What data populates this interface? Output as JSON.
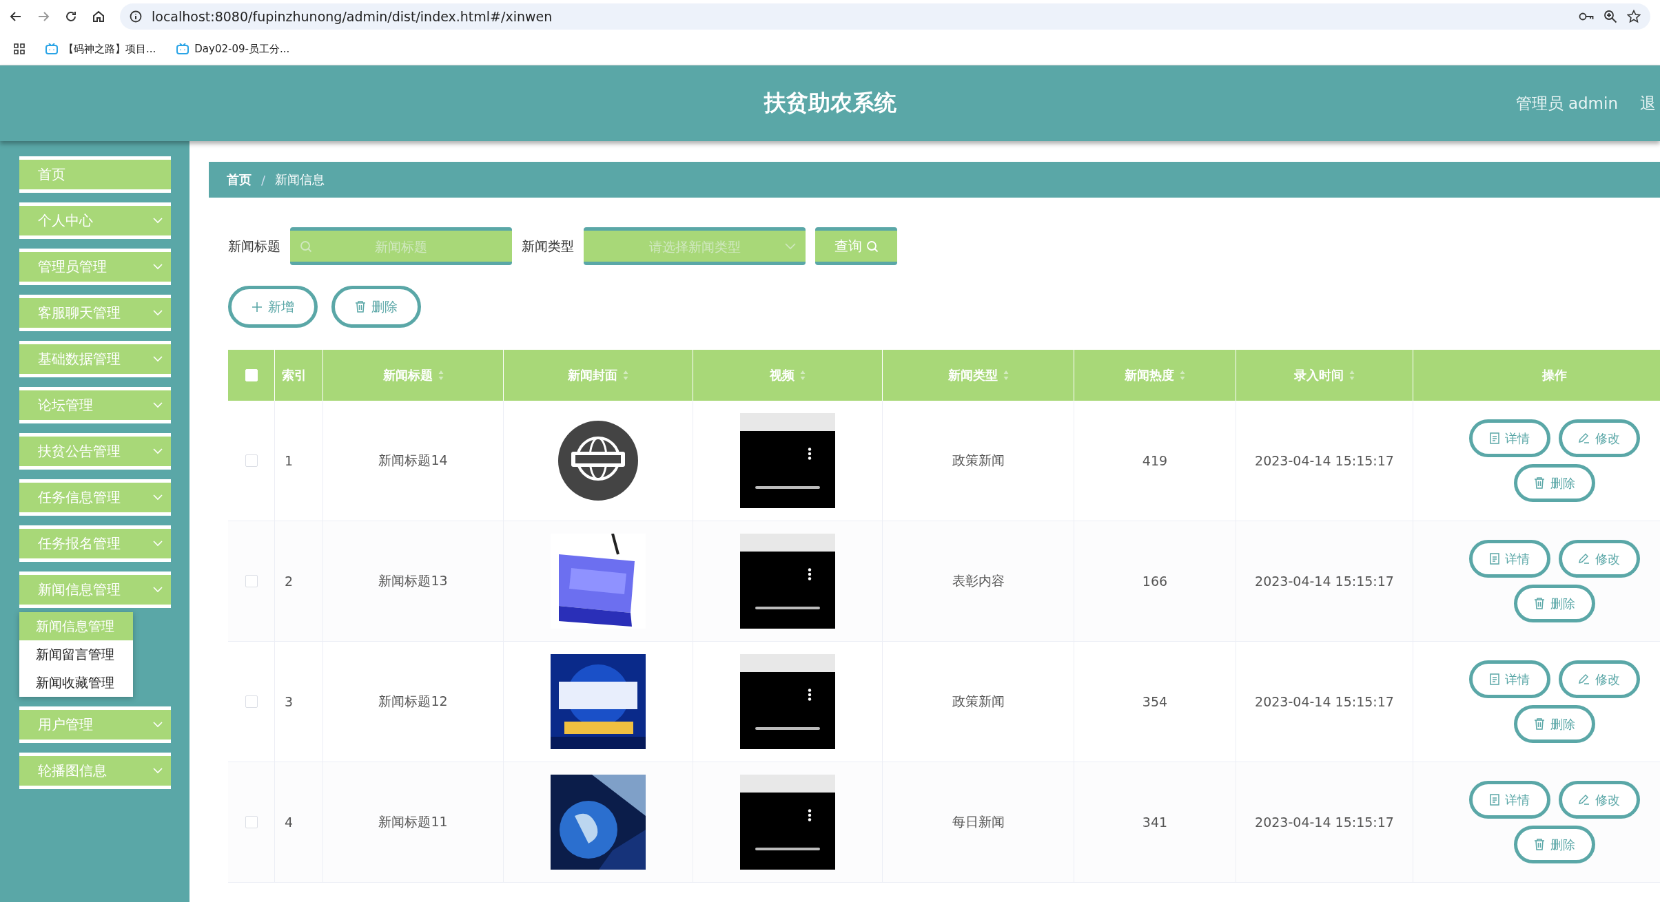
{
  "browser": {
    "url": "localhost:8080/fupinzhunong/admin/dist/index.html#/xinwen",
    "bookmarks": [
      "【码神之路】项目...",
      "Day02-09-员工分..."
    ]
  },
  "header": {
    "title": "扶贫助农系统",
    "user": "管理员 admin",
    "logout": "退"
  },
  "breadcrumb_separator": "/",
  "sidebar": {
    "items": [
      {
        "label": "首页",
        "kind": "link"
      },
      {
        "label": "个人中心",
        "kind": "menu"
      },
      {
        "label": "管理员管理",
        "kind": "menu"
      },
      {
        "label": "客服聊天管理",
        "kind": "menu"
      },
      {
        "label": "基础数据管理",
        "kind": "menu"
      },
      {
        "label": "论坛管理",
        "kind": "menu"
      },
      {
        "label": "扶贫公告管理",
        "kind": "menu"
      },
      {
        "label": "任务信息管理",
        "kind": "menu"
      },
      {
        "label": "任务报名管理",
        "kind": "menu"
      },
      {
        "label": "新闻信息管理",
        "kind": "menu",
        "children": [
          {
            "label": "新闻信息管理",
            "selected": true
          },
          {
            "label": "新闻留言管理",
            "selected": false
          },
          {
            "label": "新闻收藏管理",
            "selected": false
          }
        ]
      },
      {
        "label": "用户管理",
        "kind": "menu"
      },
      {
        "label": "轮播图信息",
        "kind": "menu"
      }
    ]
  },
  "breadcrumb": [
    "首页",
    "新闻信息"
  ],
  "search": {
    "fields": [
      {
        "label": "新闻标题",
        "kind": "input",
        "placeholder": "新闻标题"
      },
      {
        "label": "新闻类型",
        "kind": "select",
        "placeholder": "请选择新闻类型"
      }
    ],
    "button": "查询"
  },
  "actions": [
    "新增",
    "删除"
  ],
  "table": {
    "select_all": {
      "checked": false
    },
    "columns": [
      {
        "label": "索引",
        "sortable": false
      },
      {
        "label": "新闻标题",
        "sortable": true
      },
      {
        "label": "新闻封面",
        "sortable": true
      },
      {
        "label": "视频",
        "sortable": true
      },
      {
        "label": "新闻类型",
        "sortable": true
      },
      {
        "label": "新闻热度",
        "sortable": true
      },
      {
        "label": "录入时间",
        "sortable": true
      },
      {
        "label": "操作",
        "sortable": false
      }
    ],
    "rows": [
      {
        "checked": false,
        "index": "1",
        "title": "新闻标题14",
        "cover": {
          "kind": "picture"
        },
        "type": "政策新闻",
        "heat": "419",
        "time": "2023-04-14 15:15:17",
        "actions": [
          "详情",
          "修改",
          "删除"
        ]
      },
      {
        "checked": false,
        "index": "2",
        "title": "新闻标题13",
        "cover": {
          "kind": "picture"
        },
        "type": "表彰内容",
        "heat": "166",
        "time": "2023-04-14 15:15:17",
        "actions": [
          "详情",
          "修改",
          "删除"
        ]
      },
      {
        "checked": false,
        "index": "3",
        "title": "新闻标题12",
        "cover": {
          "kind": "picture"
        },
        "type": "政策新闻",
        "heat": "354",
        "time": "2023-04-14 15:15:17",
        "actions": [
          "详情",
          "修改",
          "删除"
        ]
      },
      {
        "checked": false,
        "index": "4",
        "title": "新闻标题11",
        "cover": {
          "kind": "picture"
        },
        "type": "每日新闻",
        "heat": "341",
        "time": "2023-04-14 15:15:17",
        "actions": [
          "详情",
          "修改",
          "删除"
        ]
      }
    ]
  }
}
